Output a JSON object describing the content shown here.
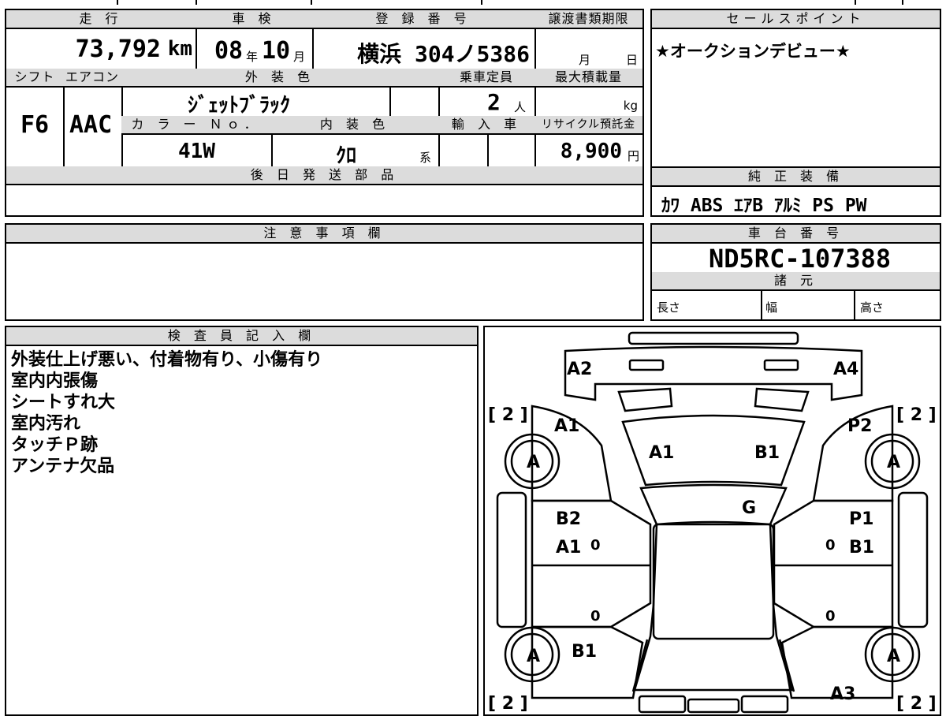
{
  "header": {
    "mileage_label": "走 行",
    "mileage_value": "73,792",
    "mileage_unit": "km",
    "inspection_label": "車 検",
    "inspection_year": "08",
    "inspection_year_unit": "年",
    "inspection_month": "10",
    "inspection_month_unit": "月",
    "registration_label": "登 録 番 号",
    "registration_value": "横浜 304ノ5386",
    "transfer_label": "譲渡書類期限",
    "transfer_month_unit": "月",
    "transfer_day_unit": "日"
  },
  "row2": {
    "shift_label": "シフト",
    "shift_value": "F6",
    "ac_label": "エアコン",
    "ac_value": "AAC",
    "exterior_color_label": "外 装 色",
    "exterior_color_value": "ｼﾞｪｯﾄﾌﾞﾗｯｸ",
    "capacity_label": "乗車定員",
    "capacity_value": "2",
    "capacity_unit": "人",
    "max_load_label": "最大積載量",
    "max_load_unit": "kg",
    "color_no_label": "カ ラ ー Ｎｏ．",
    "color_no_value": "41W",
    "interior_color_label": "内 装 色",
    "interior_color_value": "ｸﾛ",
    "interior_color_unit": "系",
    "import_label": "輸 入 車",
    "recycle_label": "リサイクル預託金",
    "recycle_value": "8,900",
    "recycle_unit": "円"
  },
  "later_parts_label": "後 日 発 送 部 品",
  "sales_point": {
    "label": "セールスポイント",
    "value": "★オークションデビュー★"
  },
  "genuine_equipment": {
    "label": "純 正 装 備",
    "value": "ｶﾜ ABS ｴｱB ｱﾙﾐ PS PW"
  },
  "notes_label": "注 意 事 項 欄",
  "chassis": {
    "label": "車 台 番 号",
    "value": "ND5RC-107388"
  },
  "specs": {
    "label": "諸 元",
    "length": "長さ",
    "width": "幅",
    "height": "高さ"
  },
  "inspector": {
    "label": "検 査 員 記 入 欄",
    "remarks": [
      "外装仕上げ悪い、付着物有り、小傷有り",
      "室内内張傷",
      "シートすれ大",
      "室内汚れ",
      "タッチＰ跡",
      "アンテナ欠品"
    ]
  },
  "diagram": {
    "A2": "A2",
    "A4": "A4",
    "tire_fl_depth": "[ 2 ]",
    "tire_fr_depth": "[ 2 ]",
    "tire_rl_depth": "[ 2 ]",
    "tire_rr_depth": "[ 2 ]",
    "front_left_fender": "A1",
    "front_right_fender": "P2",
    "hood_left": "A1",
    "hood_right": "B1",
    "windshield": "G",
    "front_left_door_1": "B2",
    "front_left_door_2": "A1",
    "front_right_door_1": "P1",
    "front_right_door_2": "B1",
    "left_rocker_1": "0",
    "left_rocker_2": "0",
    "right_rocker_1": "0",
    "right_rocker_2": "0",
    "rear_left_fender": "B1",
    "rear_right_fender": "A3",
    "wheel_fl": "A",
    "wheel_fr": "A",
    "wheel_rl": "A",
    "wheel_rr": "A"
  }
}
